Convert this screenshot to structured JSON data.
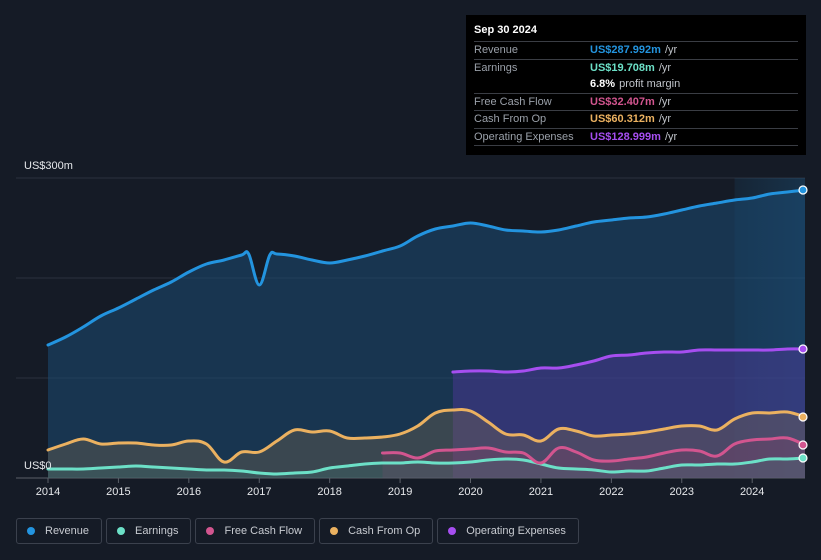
{
  "tooltip": {
    "date": "Sep 30 2024",
    "rows": [
      {
        "label": "Revenue",
        "value": "US$287.992m",
        "unit": "/yr",
        "color": "#2394df"
      },
      {
        "label": "Earnings",
        "value": "US$19.708m",
        "unit": "/yr",
        "color": "#6ce0c7"
      },
      {
        "label": "",
        "value": "6.8%",
        "unit": "profit margin",
        "color": "#ffffff"
      },
      {
        "label": "Free Cash Flow",
        "value": "US$32.407m",
        "unit": "/yr",
        "color": "#d2558f"
      },
      {
        "label": "Cash From Op",
        "value": "US$60.312m",
        "unit": "/yr",
        "color": "#ebb160"
      },
      {
        "label": "Operating Expenses",
        "value": "US$128.999m",
        "unit": "/yr",
        "color": "#a64ef0"
      }
    ]
  },
  "legend": [
    {
      "label": "Revenue",
      "color": "#2394df"
    },
    {
      "label": "Earnings",
      "color": "#6ce0c7"
    },
    {
      "label": "Free Cash Flow",
      "color": "#d2558f"
    },
    {
      "label": "Cash From Op",
      "color": "#ebb160"
    },
    {
      "label": "Operating Expenses",
      "color": "#a64ef0"
    }
  ],
  "chart_data": {
    "type": "area",
    "title": "",
    "xlabel": "",
    "ylabel": "",
    "unit": "US$m",
    "ylim": [
      0,
      300
    ],
    "xlim": [
      2014.0,
      2024.75
    ],
    "y_tick_labels": [
      "US$0",
      "US$300m"
    ],
    "y_gridlines": [
      0,
      100,
      200,
      300
    ],
    "x_tick_labels": [
      "2014",
      "2015",
      "2016",
      "2017",
      "2018",
      "2019",
      "2020",
      "2021",
      "2022",
      "2023",
      "2024"
    ],
    "highlight_range": [
      2023.75,
      2024.75
    ],
    "legend_position": "bottom",
    "series": [
      {
        "name": "Revenue",
        "color": "#2394df",
        "points": [
          [
            2014.0,
            133
          ],
          [
            2014.25,
            141
          ],
          [
            2014.5,
            151
          ],
          [
            2014.75,
            162
          ],
          [
            2015.0,
            170
          ],
          [
            2015.25,
            179
          ],
          [
            2015.5,
            188
          ],
          [
            2015.75,
            196
          ],
          [
            2016.0,
            206
          ],
          [
            2016.25,
            214
          ],
          [
            2016.5,
            218
          ],
          [
            2016.75,
            223
          ],
          [
            2016.85,
            224
          ],
          [
            2017.0,
            193
          ],
          [
            2017.15,
            223
          ],
          [
            2017.25,
            224
          ],
          [
            2017.5,
            222
          ],
          [
            2017.75,
            218
          ],
          [
            2018.0,
            215
          ],
          [
            2018.25,
            218
          ],
          [
            2018.5,
            222
          ],
          [
            2018.75,
            227
          ],
          [
            2019.0,
            232
          ],
          [
            2019.25,
            242
          ],
          [
            2019.5,
            249
          ],
          [
            2019.75,
            252
          ],
          [
            2020.0,
            255
          ],
          [
            2020.25,
            252
          ],
          [
            2020.5,
            248
          ],
          [
            2020.75,
            247
          ],
          [
            2021.0,
            246
          ],
          [
            2021.25,
            248
          ],
          [
            2021.5,
            252
          ],
          [
            2021.75,
            256
          ],
          [
            2022.0,
            258
          ],
          [
            2022.25,
            260
          ],
          [
            2022.5,
            261
          ],
          [
            2022.75,
            264
          ],
          [
            2023.0,
            268
          ],
          [
            2023.25,
            272
          ],
          [
            2023.5,
            275
          ],
          [
            2023.75,
            278
          ],
          [
            2024.0,
            280
          ],
          [
            2024.25,
            284
          ],
          [
            2024.5,
            286
          ],
          [
            2024.75,
            288
          ]
        ]
      },
      {
        "name": "Earnings",
        "color": "#6ce0c7",
        "points": [
          [
            2014.0,
            9
          ],
          [
            2014.25,
            9
          ],
          [
            2014.5,
            9
          ],
          [
            2014.75,
            10
          ],
          [
            2015.0,
            11
          ],
          [
            2015.25,
            12
          ],
          [
            2015.5,
            11
          ],
          [
            2015.75,
            10
          ],
          [
            2016.0,
            9
          ],
          [
            2016.25,
            8
          ],
          [
            2016.5,
            8
          ],
          [
            2016.75,
            7
          ],
          [
            2017.0,
            5
          ],
          [
            2017.25,
            4
          ],
          [
            2017.5,
            5
          ],
          [
            2017.75,
            6
          ],
          [
            2018.0,
            10
          ],
          [
            2018.25,
            12
          ],
          [
            2018.5,
            14
          ],
          [
            2018.75,
            15
          ],
          [
            2019.0,
            15
          ],
          [
            2019.25,
            16
          ],
          [
            2019.5,
            15
          ],
          [
            2019.75,
            15
          ],
          [
            2020.0,
            16
          ],
          [
            2020.25,
            18
          ],
          [
            2020.5,
            19
          ],
          [
            2020.75,
            18
          ],
          [
            2021.0,
            14
          ],
          [
            2021.25,
            10
          ],
          [
            2021.5,
            9
          ],
          [
            2021.75,
            8
          ],
          [
            2022.0,
            6
          ],
          [
            2022.25,
            7
          ],
          [
            2022.5,
            7
          ],
          [
            2022.75,
            10
          ],
          [
            2023.0,
            13
          ],
          [
            2023.25,
            13
          ],
          [
            2023.5,
            14
          ],
          [
            2023.75,
            14
          ],
          [
            2024.0,
            16
          ],
          [
            2024.25,
            19
          ],
          [
            2024.5,
            19
          ],
          [
            2024.75,
            20
          ]
        ]
      },
      {
        "name": "Free Cash Flow",
        "color": "#d2558f",
        "points": [
          [
            2018.75,
            25
          ],
          [
            2019.0,
            25
          ],
          [
            2019.25,
            20
          ],
          [
            2019.5,
            27
          ],
          [
            2019.75,
            28
          ],
          [
            2020.0,
            29
          ],
          [
            2020.25,
            30
          ],
          [
            2020.5,
            26
          ],
          [
            2020.75,
            25
          ],
          [
            2021.0,
            15
          ],
          [
            2021.25,
            30
          ],
          [
            2021.5,
            26
          ],
          [
            2021.75,
            18
          ],
          [
            2022.0,
            17
          ],
          [
            2022.25,
            19
          ],
          [
            2022.5,
            21
          ],
          [
            2022.75,
            25
          ],
          [
            2023.0,
            28
          ],
          [
            2023.25,
            27
          ],
          [
            2023.5,
            22
          ],
          [
            2023.75,
            34
          ],
          [
            2024.0,
            38
          ],
          [
            2024.25,
            39
          ],
          [
            2024.5,
            40
          ],
          [
            2024.75,
            33
          ]
        ]
      },
      {
        "name": "Cash From Op",
        "color": "#ebb160",
        "points": [
          [
            2014.0,
            28
          ],
          [
            2014.25,
            34
          ],
          [
            2014.5,
            39
          ],
          [
            2014.75,
            34
          ],
          [
            2015.0,
            35
          ],
          [
            2015.25,
            35
          ],
          [
            2015.5,
            33
          ],
          [
            2015.75,
            33
          ],
          [
            2016.0,
            37
          ],
          [
            2016.25,
            34
          ],
          [
            2016.5,
            16
          ],
          [
            2016.75,
            26
          ],
          [
            2017.0,
            26
          ],
          [
            2017.25,
            37
          ],
          [
            2017.5,
            48
          ],
          [
            2017.75,
            46
          ],
          [
            2018.0,
            47
          ],
          [
            2018.25,
            40
          ],
          [
            2018.5,
            40
          ],
          [
            2018.75,
            41
          ],
          [
            2019.0,
            44
          ],
          [
            2019.25,
            52
          ],
          [
            2019.5,
            65
          ],
          [
            2019.75,
            68
          ],
          [
            2020.0,
            67
          ],
          [
            2020.25,
            56
          ],
          [
            2020.5,
            44
          ],
          [
            2020.75,
            43
          ],
          [
            2021.0,
            37
          ],
          [
            2021.25,
            49
          ],
          [
            2021.5,
            47
          ],
          [
            2021.75,
            42
          ],
          [
            2022.0,
            43
          ],
          [
            2022.25,
            44
          ],
          [
            2022.5,
            46
          ],
          [
            2022.75,
            49
          ],
          [
            2023.0,
            52
          ],
          [
            2023.25,
            52
          ],
          [
            2023.5,
            48
          ],
          [
            2023.75,
            59
          ],
          [
            2024.0,
            65
          ],
          [
            2024.25,
            65
          ],
          [
            2024.5,
            66
          ],
          [
            2024.75,
            61
          ]
        ]
      },
      {
        "name": "Operating Expenses",
        "color": "#a64ef0",
        "points": [
          [
            2019.75,
            106
          ],
          [
            2020.0,
            107
          ],
          [
            2020.25,
            107
          ],
          [
            2020.5,
            106
          ],
          [
            2020.75,
            107
          ],
          [
            2021.0,
            110
          ],
          [
            2021.25,
            110
          ],
          [
            2021.5,
            113
          ],
          [
            2021.75,
            117
          ],
          [
            2022.0,
            122
          ],
          [
            2022.25,
            123
          ],
          [
            2022.5,
            125
          ],
          [
            2022.75,
            126
          ],
          [
            2023.0,
            126
          ],
          [
            2023.25,
            128
          ],
          [
            2023.5,
            128
          ],
          [
            2023.75,
            128
          ],
          [
            2024.0,
            128
          ],
          [
            2024.25,
            128
          ],
          [
            2024.5,
            129
          ],
          [
            2024.75,
            129
          ]
        ]
      }
    ]
  }
}
